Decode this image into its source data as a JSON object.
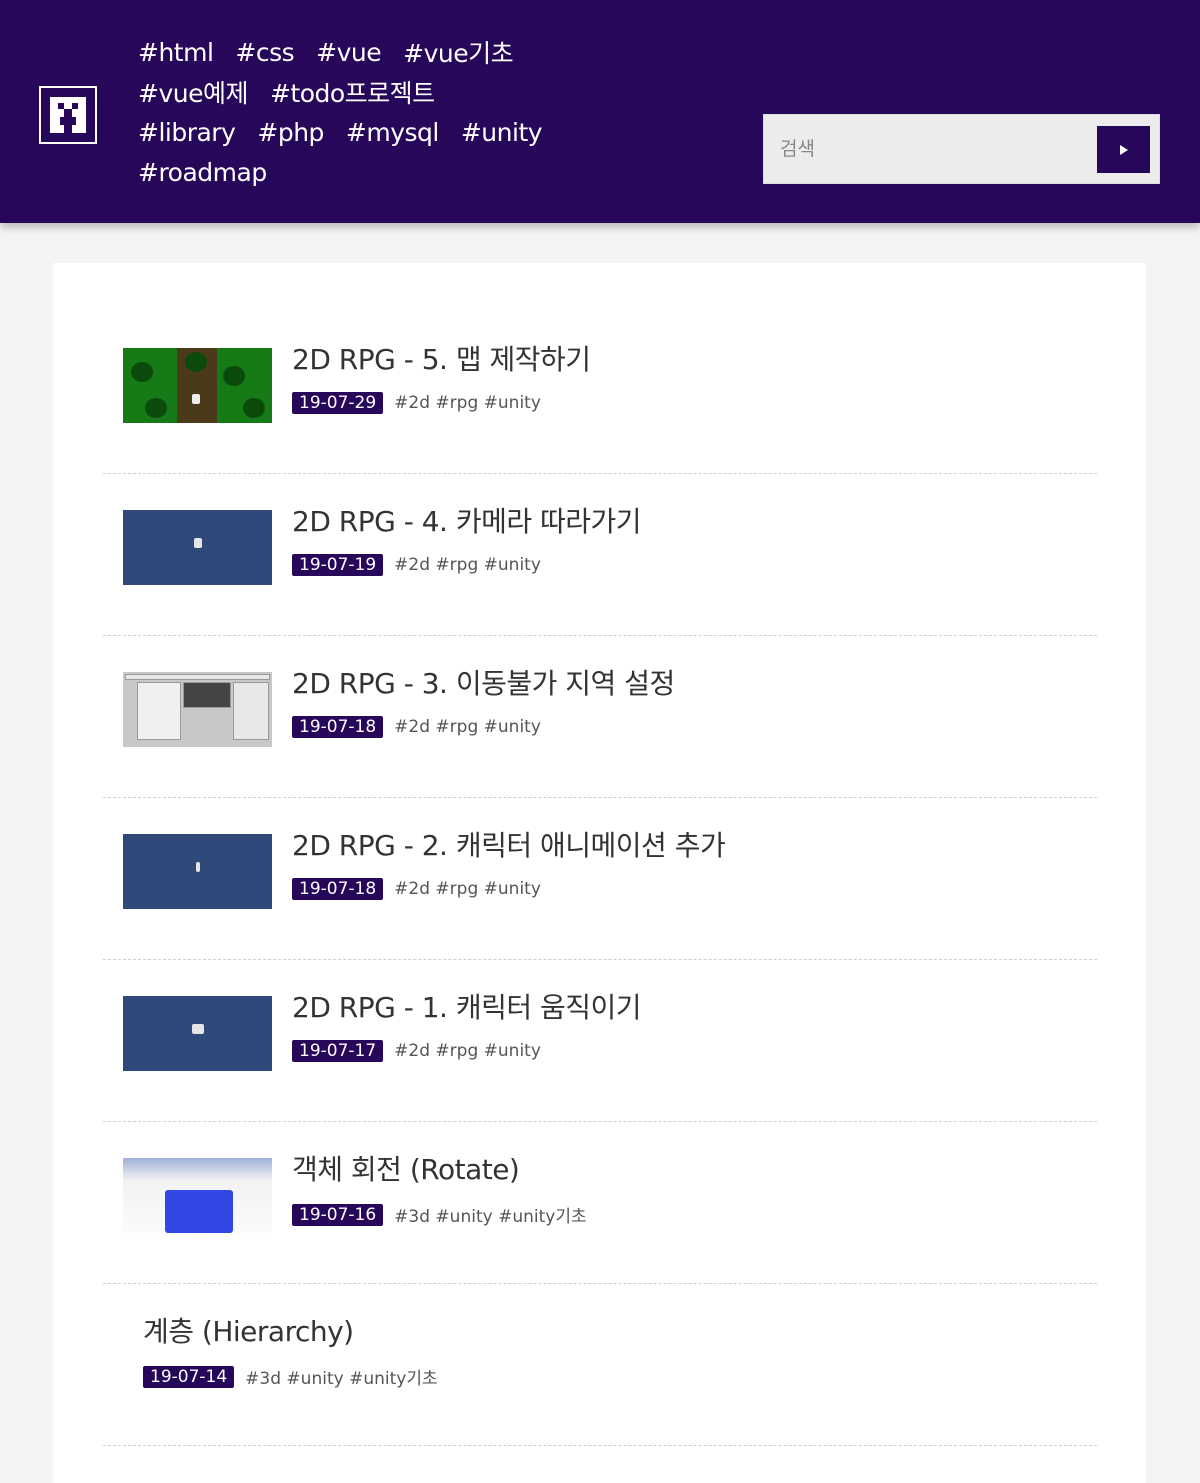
{
  "header": {
    "tag_rows": [
      [
        "#html",
        "#css",
        "#vue",
        "#vue기초"
      ],
      [
        "#vue예제",
        "#todo프로젝트"
      ],
      [
        "#library",
        "#php",
        "#mysql",
        "#unity"
      ],
      [
        "#roadmap"
      ]
    ],
    "search": {
      "placeholder": "검색"
    }
  },
  "posts": [
    {
      "title": "2D RPG - 5. 맵 제작하기",
      "date": "19-07-29",
      "tags": "#2d #rpg #unity",
      "thumb": "forest-map"
    },
    {
      "title": "2D RPG - 4. 카메라 따라가기",
      "date": "19-07-19",
      "tags": "#2d #rpg #unity",
      "thumb": "blue-scene"
    },
    {
      "title": "2D RPG - 3. 이동불가 지역 설정",
      "date": "19-07-18",
      "tags": "#2d #rpg #unity",
      "thumb": "editor-screen"
    },
    {
      "title": "2D RPG - 2. 캐릭터 애니메이션 추가",
      "date": "19-07-18",
      "tags": "#2d #rpg #unity",
      "thumb": "blue-scene"
    },
    {
      "title": "2D RPG - 1. 캐릭터 움직이기",
      "date": "19-07-17",
      "tags": "#2d #rpg #unity",
      "thumb": "blue-scene"
    },
    {
      "title": "객체 회전 (Rotate)",
      "date": "19-07-16",
      "tags": "#3d #unity #unity기초",
      "thumb": "blue-cube"
    },
    {
      "title": "계층 (Hierarchy)",
      "date": "19-07-14",
      "tags": "#3d #unity #unity기초",
      "thumb": ""
    }
  ],
  "colors": {
    "brand": "#27075a",
    "background": "#f4f4f4",
    "card": "#ffffff"
  }
}
